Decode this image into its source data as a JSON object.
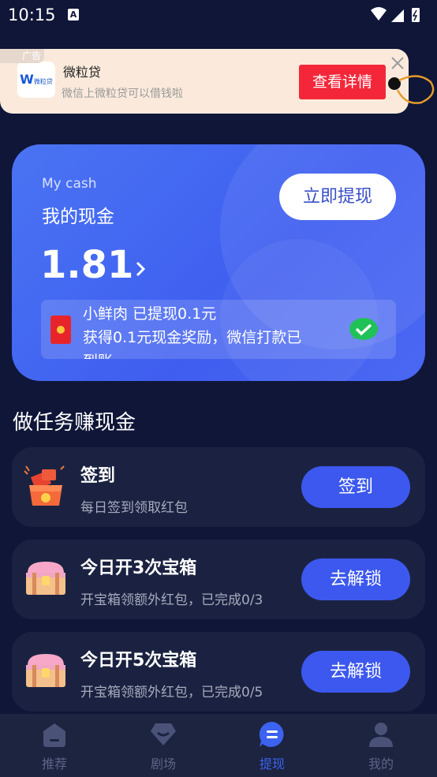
{
  "status": {
    "time": "10:15",
    "a_badge": "A"
  },
  "ad": {
    "logo_text": "微粒贷",
    "logo_letter": "W",
    "title": "微粒贷",
    "subtitle": "微信上微粒贷可以借钱啦",
    "button_label": "查看详情",
    "tag": "广告"
  },
  "cash": {
    "en_label": "My cash",
    "title": "我的现金",
    "withdraw_label": "立即提现",
    "amount": "1.81",
    "notice_line1": "小鲜肉 已提现0.1元",
    "notice_line2": "获得0.1元现金奖励，微信打款已",
    "notice_line3": "到账"
  },
  "tasks_title": "做任务赚现金",
  "tasks": [
    {
      "title": "签到",
      "subtitle": "每日签到领取红包",
      "button": "签到"
    },
    {
      "title": "今日开3次宝箱",
      "subtitle": "开宝箱领额外红包，已完成0/3",
      "button": "去解锁"
    },
    {
      "title": "今日开5次宝箱",
      "subtitle": "开宝箱领额外红包，已完成0/5",
      "button": "去解锁"
    }
  ],
  "tabs": [
    {
      "label": "推荐",
      "icon": "home-icon"
    },
    {
      "label": "剧场",
      "icon": "theater-icon"
    },
    {
      "label": "提现",
      "icon": "withdraw-icon"
    },
    {
      "label": "我的",
      "icon": "profile-icon"
    }
  ],
  "colors": {
    "background": "#0f1638",
    "accent": "#3c58ee",
    "ad_button": "#f4273a"
  }
}
